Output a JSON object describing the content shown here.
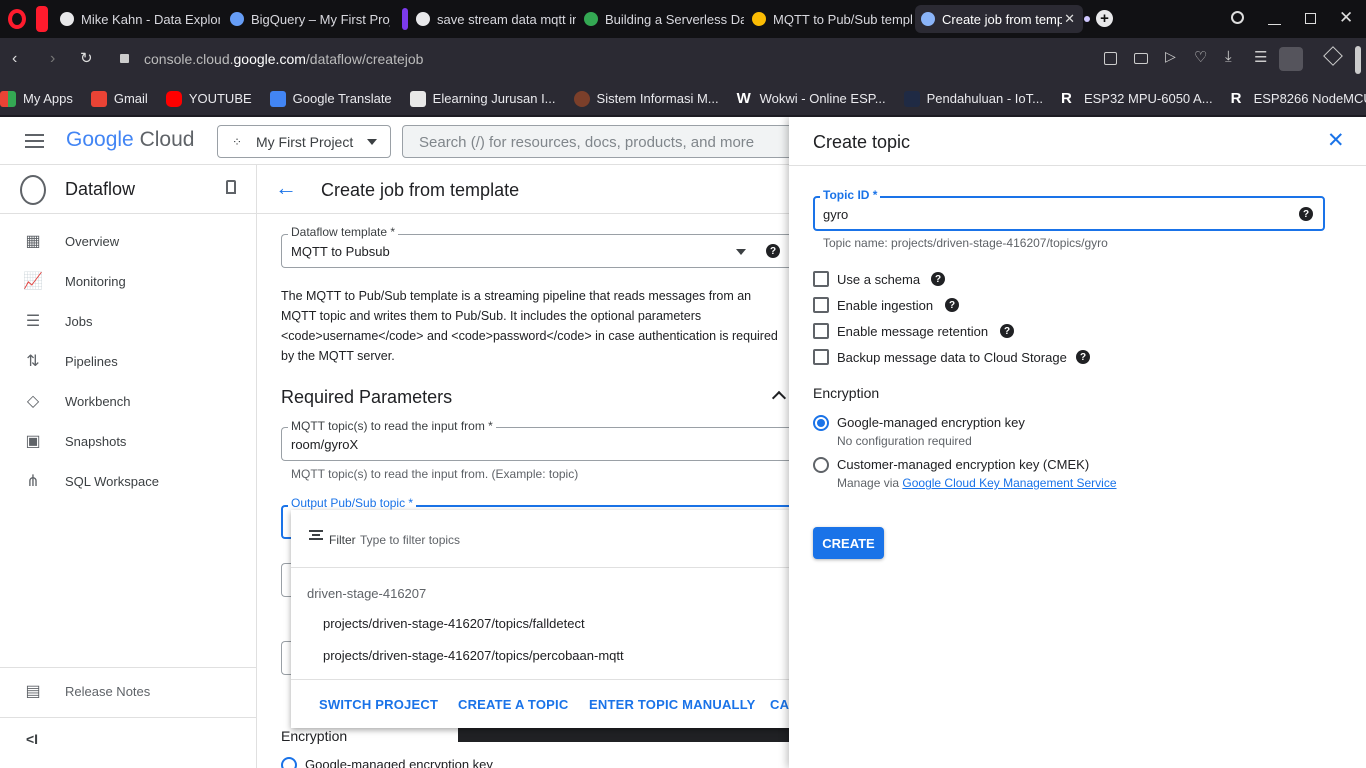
{
  "browser": {
    "tabs": [
      {
        "title": "Mike Kahn - Data Explorat"
      },
      {
        "title": "BigQuery – My First Projec"
      },
      {
        "title": "save stream data mqtt in g"
      },
      {
        "title": "Building a Serverless Data"
      },
      {
        "title": "MQTT to Pub/Sub templat"
      },
      {
        "title": "Create job from templ"
      }
    ],
    "url_prefix": "console.cloud.",
    "url_domain": "google.com",
    "url_path": "/dataflow/createjob",
    "bookmarks": [
      {
        "label": "My Apps"
      },
      {
        "label": "Gmail"
      },
      {
        "label": "YOUTUBE"
      },
      {
        "label": "Google Translate"
      },
      {
        "label": "Elearning Jurusan I..."
      },
      {
        "label": "Sistem Informasi M..."
      },
      {
        "label": "Wokwi - Online ESP..."
      },
      {
        "label": "Pendahuluan - IoT..."
      },
      {
        "label": "ESP32 MPU-6050 A..."
      },
      {
        "label": "ESP8266 NodeMCU..."
      }
    ]
  },
  "gcp": {
    "logo_google": "Google",
    "logo_cloud": "Cloud",
    "project": "My First Project",
    "search_placeholder": "Search (/) for resources, docs, products, and more",
    "product": "Dataflow",
    "nav": [
      {
        "label": "Overview",
        "icon": "dashboard-icon"
      },
      {
        "label": "Monitoring",
        "icon": "monitoring-icon"
      },
      {
        "label": "Jobs",
        "icon": "list-icon"
      },
      {
        "label": "Pipelines",
        "icon": "pipelines-icon"
      },
      {
        "label": "Workbench",
        "icon": "workbench-icon"
      },
      {
        "label": "Snapshots",
        "icon": "snapshot-icon"
      },
      {
        "label": "SQL Workspace",
        "icon": "sql-icon"
      }
    ],
    "release_notes": "Release Notes"
  },
  "main": {
    "title": "Create job from template",
    "template_label": "Dataflow template *",
    "template_value": "MQTT to Pubsub",
    "description": "The MQTT to Pub/Sub template is a streaming pipeline that reads messages from an MQTT topic and writes them to Pub/Sub. It includes the optional parameters <code>username</code> and <code>password</code> in case authentication is required by the MQTT server.",
    "required_header": "Required Parameters",
    "mqtt_label": "MQTT topic(s) to read the input from *",
    "mqtt_value": "room/gyroX",
    "mqtt_hint": "MQTT topic(s) to read the input from. (Example: topic)",
    "output_label": "Output Pub/Sub topic *",
    "encryption_label": "Encryption",
    "encryption_option": "Google-managed encryption key"
  },
  "dropdown": {
    "filter_label": "Filter",
    "filter_placeholder": "Type to filter topics",
    "group": "driven-stage-416207",
    "items": [
      "projects/driven-stage-416207/topics/falldetect",
      "projects/driven-stage-416207/topics/percobaan-mqtt"
    ],
    "actions": [
      "SWITCH PROJECT",
      "CREATE A TOPIC",
      "ENTER TOPIC MANUALLY",
      "CA"
    ]
  },
  "panel": {
    "title": "Create topic",
    "topic_id_label": "Topic ID *",
    "topic_id_value": "gyro",
    "topic_name_hint": "Topic name: projects/driven-stage-416207/topics/gyro",
    "checkboxes": [
      {
        "label": "Use a schema",
        "checked": false
      },
      {
        "label": "Enable ingestion",
        "checked": false
      },
      {
        "label": "Enable message retention",
        "checked": false
      },
      {
        "label": "Backup message data to Cloud Storage",
        "checked": false
      }
    ],
    "encryption_header": "Encryption",
    "radio_google": "Google-managed encryption key",
    "radio_google_sub": "No configuration required",
    "radio_cmek": "Customer-managed encryption key (CMEK)",
    "radio_cmek_sub_prefix": "Manage via",
    "radio_cmek_link": "Google Cloud Key Management Service",
    "create_button": "CREATE",
    "selected_radio": "google"
  },
  "colors": {
    "accent": "#1a73e8",
    "browser_dark": "#2b2a33"
  }
}
